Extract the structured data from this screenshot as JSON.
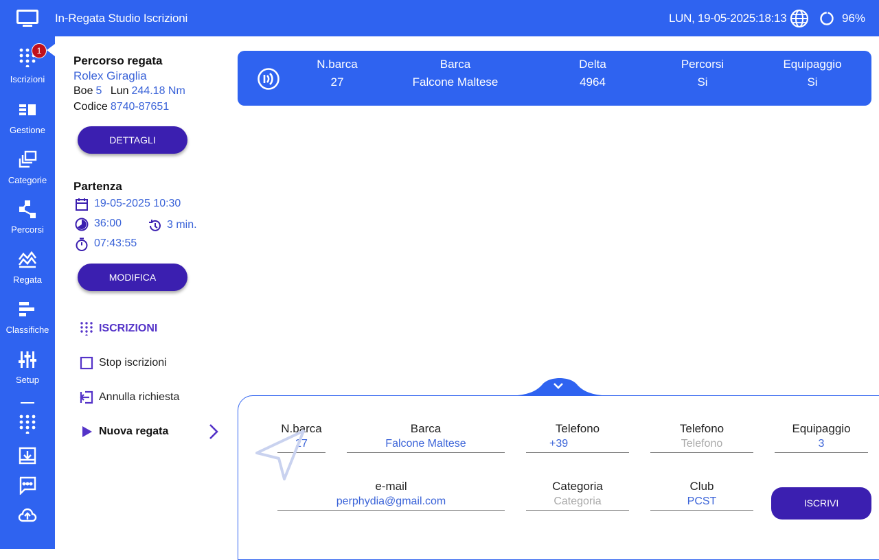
{
  "header": {
    "title": "In-Regata Studio Iscrizioni",
    "datetime": "LUN, 19-05-2025:18:13",
    "battery": "96%"
  },
  "sidebar": {
    "badge": "1",
    "items": [
      {
        "label": "Iscrizioni",
        "icon": "dialpad-icon"
      },
      {
        "label": "Gestione",
        "icon": "list-icon"
      },
      {
        "label": "Categorie",
        "icon": "layers-icon"
      },
      {
        "label": "Percorsi",
        "icon": "route-icon"
      },
      {
        "label": "Regata",
        "icon": "waves-icon"
      },
      {
        "label": "Classifiche",
        "icon": "bar-list-icon"
      },
      {
        "label": "Setup",
        "icon": "sliders-icon"
      }
    ]
  },
  "course": {
    "heading": "Percorso regata",
    "name": "Rolex Giraglia",
    "boe_label": "Boe",
    "boe_value": "5",
    "lun_label": "Lun",
    "lun_value": "244.18 Nm",
    "codice_label": "Codice",
    "codice_value": "8740-87651",
    "details_button": "DETTAGLI"
  },
  "start": {
    "heading": "Partenza",
    "date": "19-05-2025 10:30",
    "duration": "36:00",
    "delay": "3 min.",
    "timer": "07:43:55",
    "edit_button": "MODIFICA"
  },
  "menu": {
    "iscrizioni": "ISCRIZIONI",
    "stop": "Stop iscrizioni",
    "annulla": "Annulla richiesta",
    "nuova": "Nuova regata"
  },
  "boat": {
    "nbarca_label": "N.barca",
    "nbarca": "27",
    "barca_label": "Barca",
    "barca": "Falcone Maltese",
    "delta_label": "Delta",
    "delta": "4964",
    "percorsi_label": "Percorsi",
    "percorsi": "Si",
    "equipaggio_label": "Equipaggio",
    "equipaggio": "Si"
  },
  "form": {
    "nbarca": {
      "label": "N.barca",
      "value": "27"
    },
    "barca": {
      "label": "Barca",
      "value": "Falcone Maltese"
    },
    "telefono1": {
      "label": "Telefono",
      "value": "+39"
    },
    "telefono2": {
      "label": "Telefono",
      "placeholder": "Telefono"
    },
    "equipaggio": {
      "label": "Equipaggio",
      "value": "3"
    },
    "email": {
      "label": "e-mail",
      "value": "perphydia@gmail.com"
    },
    "categoria": {
      "label": "Categoria",
      "placeholder": "Categoria"
    },
    "club": {
      "label": "Club",
      "value": "PCST"
    },
    "submit": "ISCRIVI"
  }
}
